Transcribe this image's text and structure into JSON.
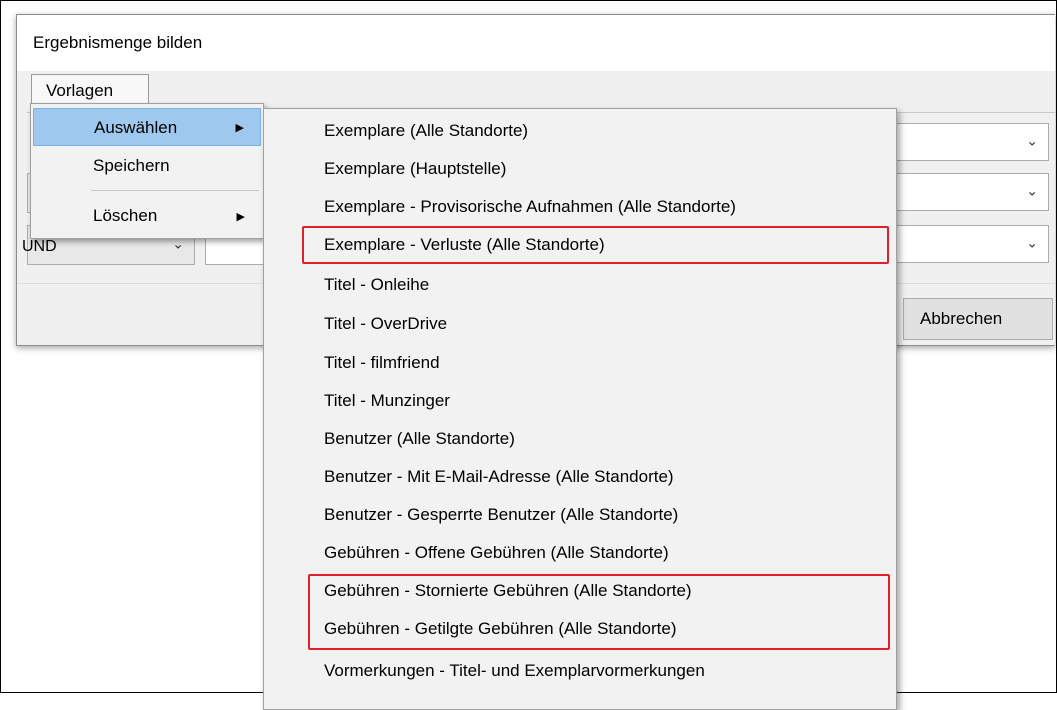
{
  "dialog": {
    "title": "Ergebnismenge bilden",
    "menu_tab": "Vorlagen",
    "operator_value": "UND",
    "cancel_label": "Abbrechen"
  },
  "menu": {
    "items": [
      {
        "label": "Auswählen",
        "has_submenu": true,
        "highlighted": true
      },
      {
        "label": "Speichern",
        "has_submenu": false
      },
      {
        "label": "Löschen",
        "has_submenu": true
      }
    ],
    "arrow_glyph": "▶"
  },
  "submenu": {
    "items": [
      "Exemplare (Alle Standorte)",
      "Exemplare (Hauptstelle)",
      "Exemplare - Provisorische Aufnahmen (Alle Standorte)",
      "Exemplare - Verluste (Alle Standorte)",
      "Titel - Onleihe",
      "Titel - OverDrive",
      "Titel - filmfriend",
      "Titel - Munzinger",
      "Benutzer (Alle Standorte)",
      "Benutzer - Mit E-Mail-Adresse (Alle Standorte)",
      "Benutzer - Gesperrte Benutzer (Alle Standorte)",
      "Gebühren - Offene Gebühren (Alle Standorte)",
      "Gebühren - Stornierte Gebühren (Alle Standorte)",
      "Gebühren - Getilgte Gebühren (Alle Standorte)",
      "Vormerkungen - Titel- und Exemplarvormerkungen"
    ],
    "annotated_items": [
      3,
      12,
      13
    ]
  },
  "icons": {
    "chevron": "chevron-down-icon",
    "submenu_arrow": "submenu-arrow-icon"
  },
  "colors": {
    "highlight": "#9ec8ee",
    "annotation": "#e0202a"
  }
}
